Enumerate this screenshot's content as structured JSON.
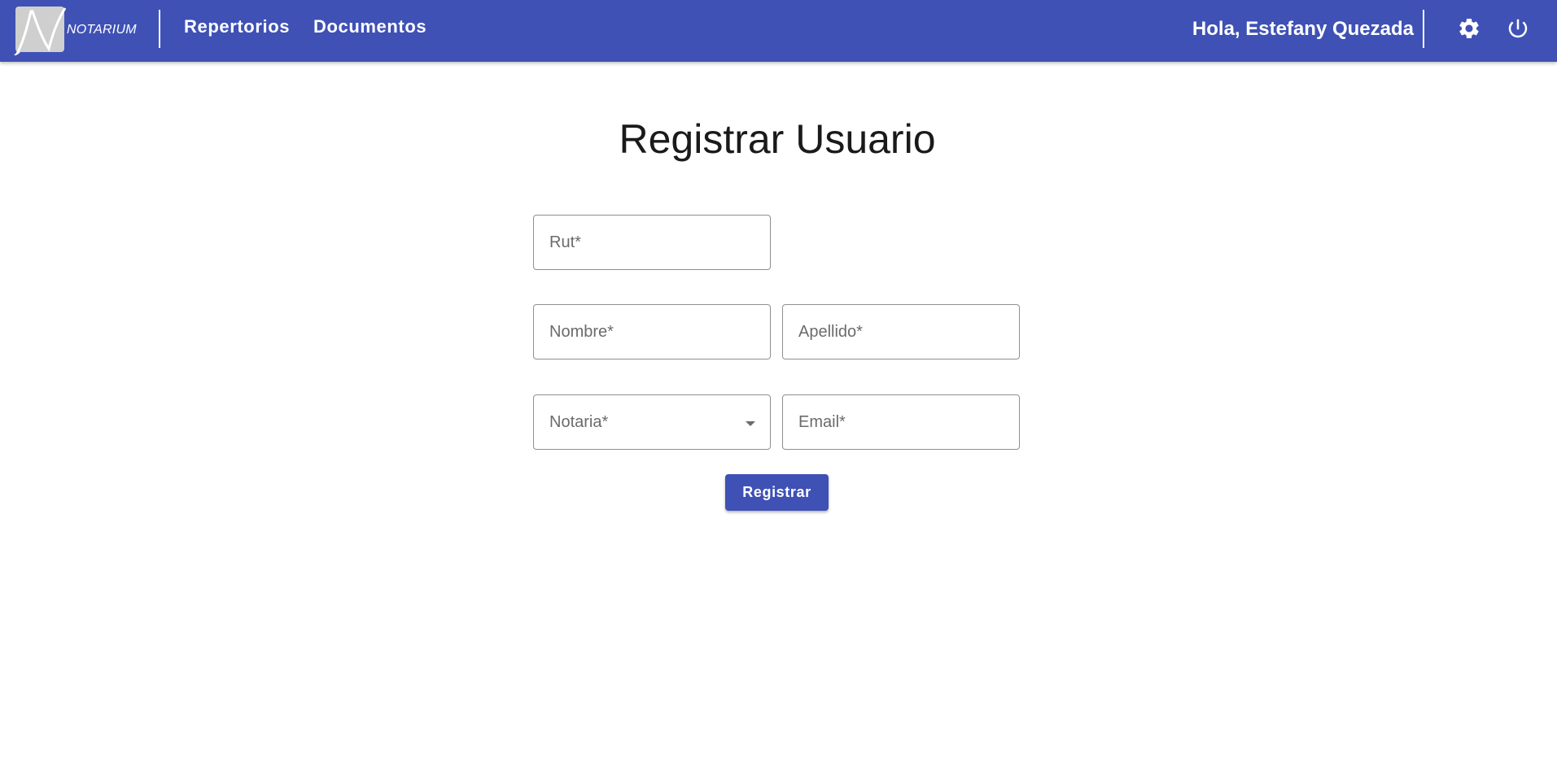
{
  "header": {
    "logo_text": "NOTARIUM",
    "nav": [
      {
        "label": "Repertorios"
      },
      {
        "label": "Documentos"
      }
    ],
    "greeting": "Hola, Estefany Quezada",
    "icons": {
      "settings": "gear-icon",
      "logout": "power-icon"
    }
  },
  "page": {
    "title": "Registrar Usuario"
  },
  "form": {
    "rut_placeholder": "Rut*",
    "nombre_placeholder": "Nombre*",
    "apellido_placeholder": "Apellido*",
    "notaria_label": "Notaria*",
    "email_placeholder": "Email*",
    "submit_label": "Registrar"
  },
  "colors": {
    "primary": "#3f51b5",
    "border": "#8f8f8f",
    "placeholder": "#6b6b6b"
  }
}
